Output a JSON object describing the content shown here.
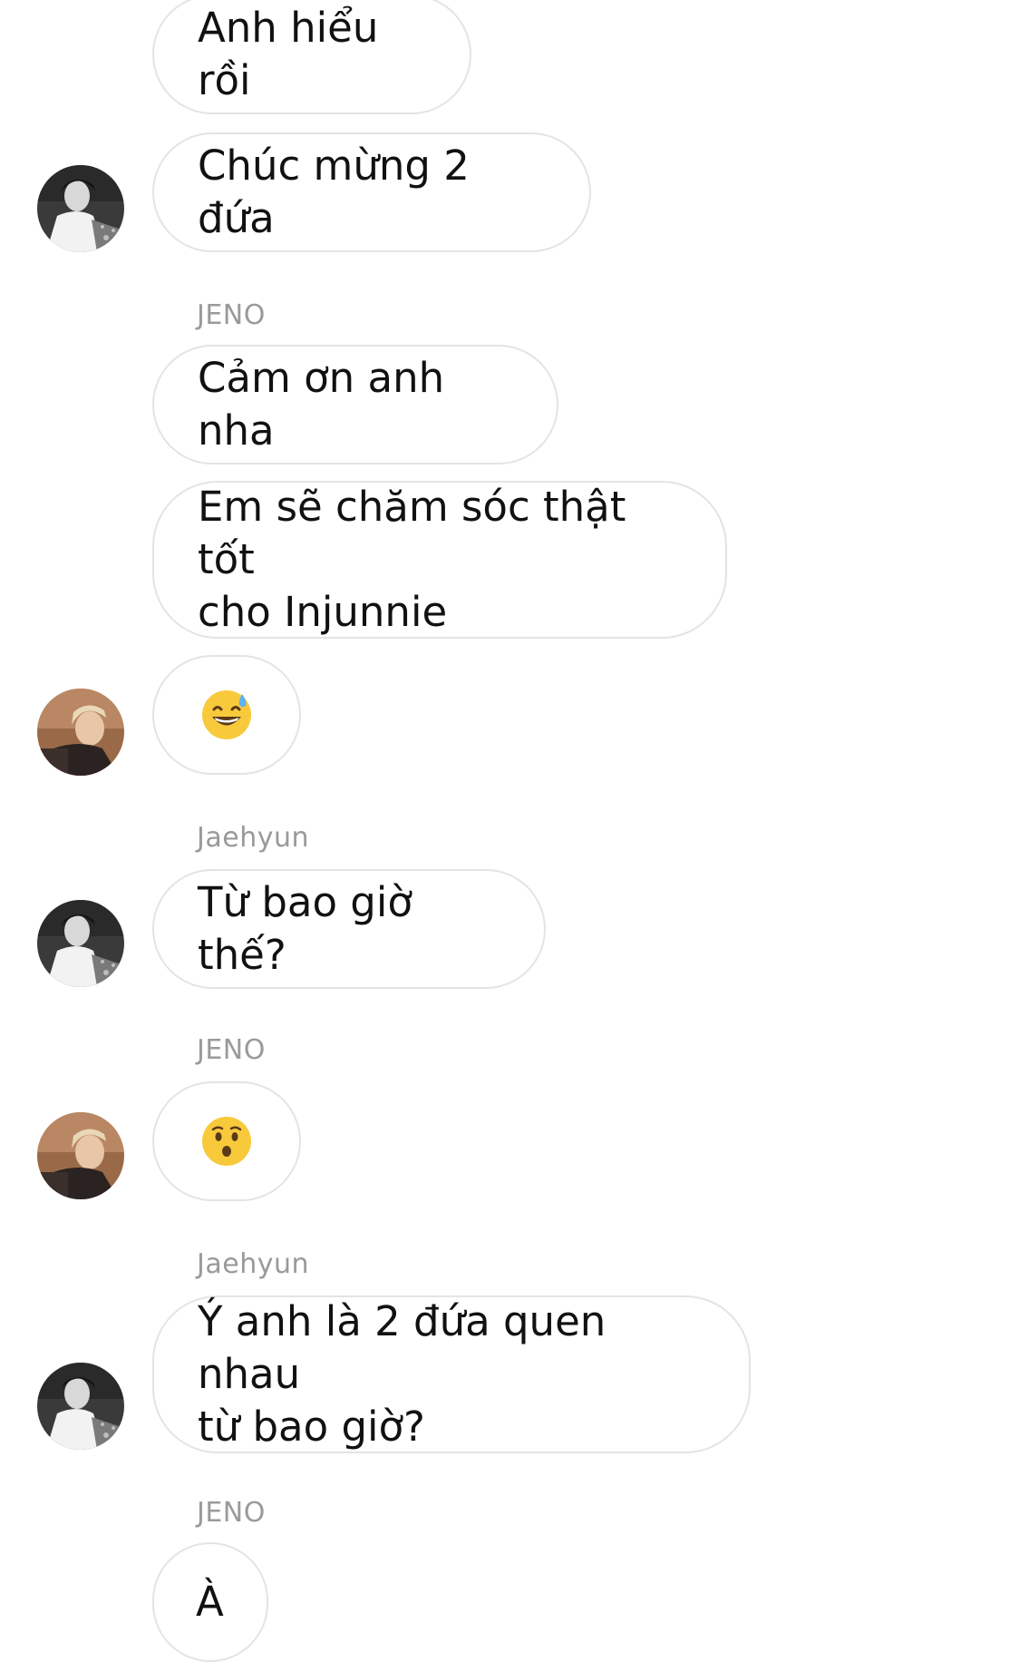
{
  "messages": [
    {
      "text": "Anh hiểu rồi"
    },
    {
      "text": "Chúc mừng 2 đứa"
    },
    {
      "sender": "JENO"
    },
    {
      "text": "Cảm ơn anh nha"
    },
    {
      "text": "Em sẽ chăm sóc thật tốt\ncho Injunnie"
    },
    {
      "emoji": "grinning-sweat-emoji"
    },
    {
      "sender": "Jaehyun"
    },
    {
      "text": "Từ bao giờ thế?"
    },
    {
      "sender": "JENO"
    },
    {
      "emoji": "hushed-face-emoji"
    },
    {
      "sender": "Jaehyun"
    },
    {
      "text": "Ý anh là 2 đứa quen nhau\ntừ bao giờ?"
    },
    {
      "sender": "JENO"
    },
    {
      "text": "À"
    }
  ],
  "avatars": {
    "jaehyun": {
      "icon": "avatar-jaehyun",
      "tone": "#6f6f6f"
    },
    "jeno": {
      "icon": "avatar-jeno",
      "tone": "#8a5a3c"
    }
  },
  "colors": {
    "bubble_border": "#e4e4e4",
    "sender_label": "#9a9a9a",
    "text": "#111111",
    "emoji_yellow": "#f9c93c"
  }
}
